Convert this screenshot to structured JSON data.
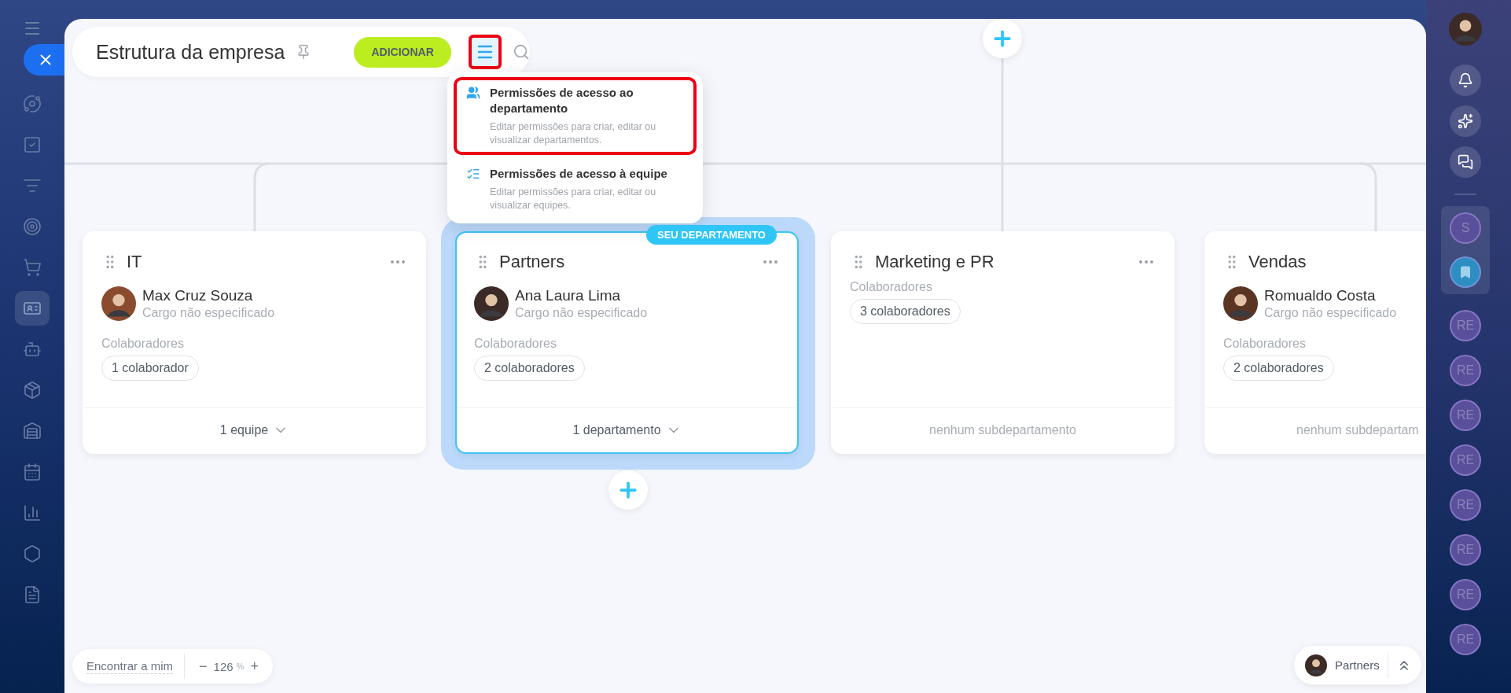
{
  "left_sidebar": {
    "items": [
      {
        "selected": false
      },
      {
        "selected": false
      },
      {
        "selected": false
      },
      {
        "selected": false
      },
      {
        "selected": false
      },
      {
        "selected": true
      },
      {
        "selected": false
      },
      {
        "selected": false
      },
      {
        "selected": false
      },
      {
        "selected": false
      },
      {
        "selected": false
      },
      {
        "selected": false
      },
      {
        "selected": false
      }
    ]
  },
  "header": {
    "title": "Estrutura da empresa",
    "add_button": "ADICIONAR",
    "menu_button": {
      "annotated": true,
      "expanded": true
    }
  },
  "menu": {
    "items": [
      {
        "title": "Permissões de acesso ao departamento",
        "description": "Editar permissões para criar, editar ou visualizar departamentos.",
        "annotated": true
      },
      {
        "title": "Permissões de acesso à equipe",
        "description": "Editar permissões para criar, editar ou visualizar equipes.",
        "annotated": false
      }
    ]
  },
  "departments": [
    {
      "title": "IT",
      "current": false,
      "head": {
        "name": "Max Cruz Souza",
        "role": "Cargo não especificado"
      },
      "employees_label": "Colaboradores",
      "employees": "1 colaborador",
      "footer": "1 equipe",
      "expandable": true
    },
    {
      "title": "Partners",
      "current": true,
      "badge": "SEU DEPARTAMENTO",
      "head": {
        "name": "Ana Laura Lima",
        "role": "Cargo não especificado"
      },
      "employees_label": "Colaboradores",
      "employees": "2 colaboradores",
      "footer": "1 departamento",
      "expandable": true
    },
    {
      "title": "Marketing e PR",
      "current": false,
      "employees_label": "Colaboradores",
      "employees": "3 colaboradores",
      "footer": "nenhum subdepartamento",
      "expandable": false
    },
    {
      "title": "Vendas",
      "current": false,
      "head": {
        "name": "Romualdo Costa",
        "role": "Cargo não especificado"
      },
      "employees_label": "Colaboradores",
      "employees": "2 colaboradores",
      "footer": "nenhum subdepartam",
      "expandable": false
    }
  ],
  "zoom": {
    "find_me": "Encontrar a mim",
    "minus": "−",
    "value": "126",
    "unit": "%",
    "plus": "+"
  },
  "current_department": {
    "name": "Partners"
  },
  "right_sidebar": {
    "pinned": [
      {
        "kind": "initials",
        "text": "S"
      },
      {
        "kind": "bookmark"
      }
    ],
    "chats": [
      {
        "text": "RE"
      },
      {
        "text": "RE"
      },
      {
        "text": "RE"
      },
      {
        "text": "RE"
      },
      {
        "text": "RE"
      },
      {
        "text": "RE"
      },
      {
        "text": "RE"
      },
      {
        "text": "RE"
      }
    ]
  }
}
